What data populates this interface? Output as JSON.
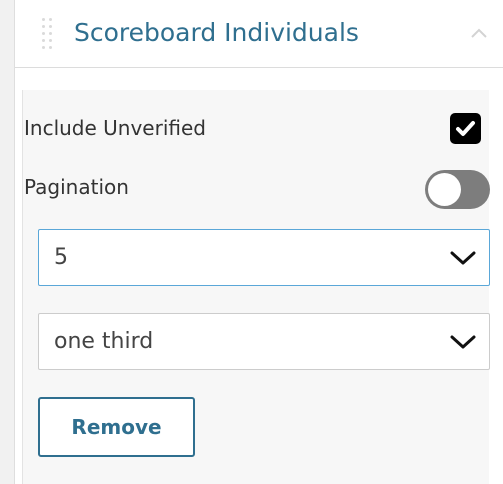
{
  "header": {
    "title": "Scoreboard Individuals",
    "drag_icon": "drag-handle-icon",
    "collapse_icon": "chevron-up-icon"
  },
  "settings": {
    "include_unverified": {
      "label": "Include Unverified",
      "checked": true
    },
    "pagination": {
      "label": "Pagination",
      "enabled": false
    },
    "page_size_select": {
      "value": "5"
    },
    "width_select": {
      "value": "one third"
    }
  },
  "actions": {
    "remove_label": "Remove"
  },
  "colors": {
    "accent": "#2f6f8f",
    "focus_border": "#5aa7d8",
    "toggle_off": "#7d7d7d"
  }
}
